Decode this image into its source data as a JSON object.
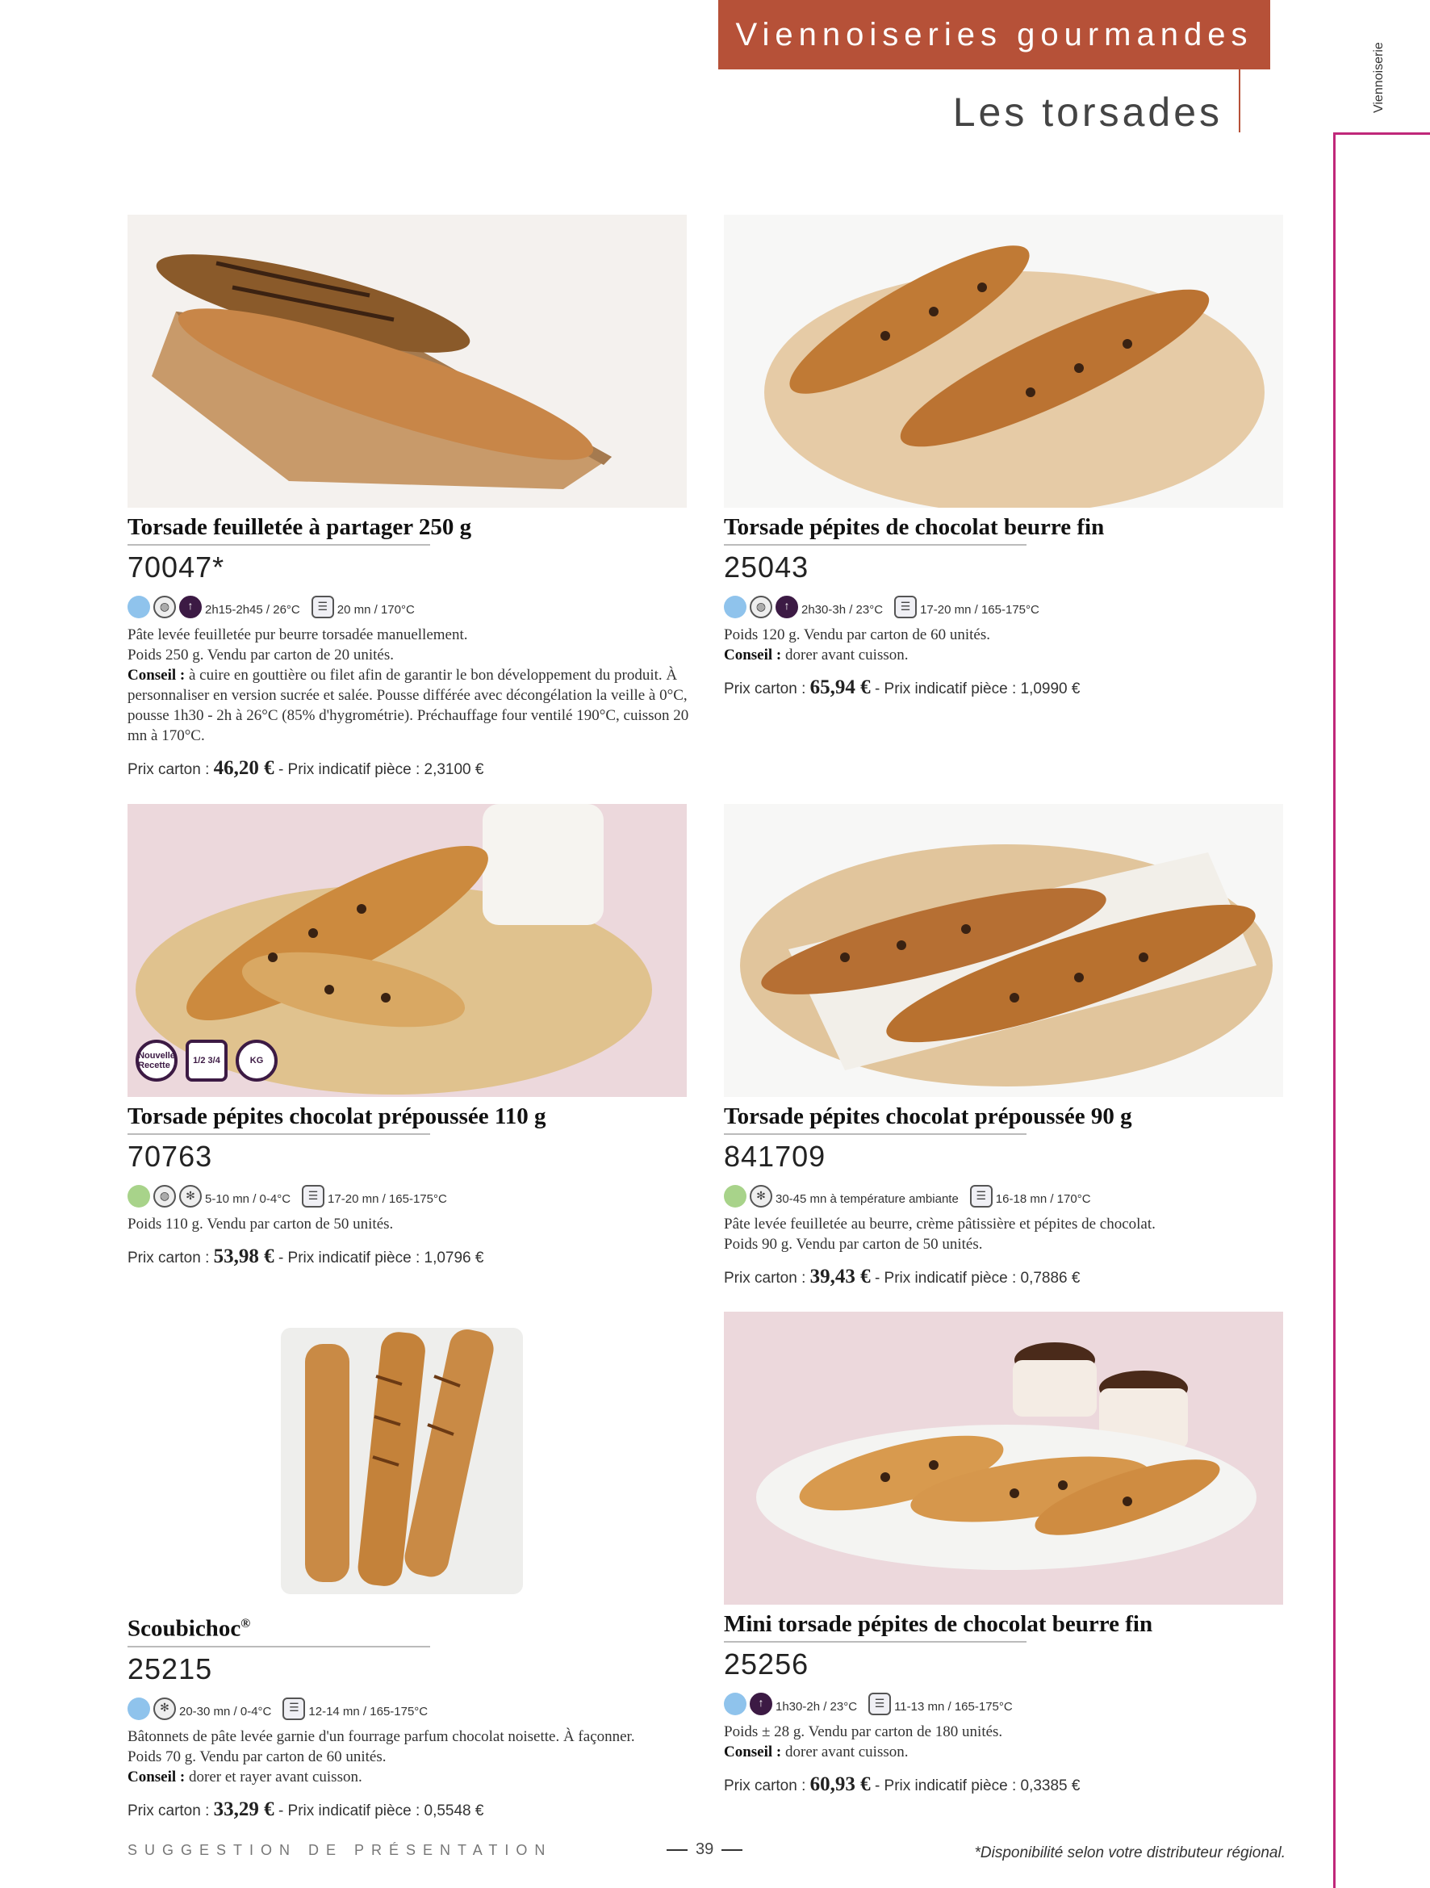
{
  "header": {
    "banner": "Viennoiseries gourmandes",
    "subtitle": "Les torsades",
    "side_label": "Viennoiserie",
    "banner_color": "#b65138",
    "accent_color": "#c0287a"
  },
  "products": [
    {
      "name": "Torsade feuilletée à partager 250 g",
      "code": "70047*",
      "dot_color": "#8fc3ec",
      "icons": [
        "butter-icon",
        "proofing-icon",
        "oven-icon"
      ],
      "proof": "2h15-2h45 / 26°C",
      "bake": "20 mn / 170°C",
      "desc": [
        "Pâte levée feuilletée pur beurre torsadée manuellement.",
        "Poids 250 g. Vendu par carton de 20 unités."
      ],
      "conseil_label": "Conseil :",
      "conseil": "à cuire en gouttière ou filet afin de garantir le bon développement du produit. À personnaliser en version sucrée et salée. Pousse différée avec décongélation la veille à 0°C, pousse 1h30 - 2h à 26°C (85% d'hygrométrie). Préchauffage four ventilé 190°C, cuisson 20 mn à 170°C.",
      "price_label": "Prix carton :",
      "price": "46,20 €",
      "unit_label": "- Prix indicatif pièce : 2,3100 €"
    },
    {
      "name": "Torsade pépites de chocolat beurre fin",
      "code": "25043",
      "dot_color": "#8fc3ec",
      "icons": [
        "butter-icon",
        "proofing-icon",
        "oven-icon"
      ],
      "proof": "2h30-3h / 23°C",
      "bake": "17-20 mn / 165-175°C",
      "desc": [
        "Poids 120 g. Vendu par carton de 60 unités."
      ],
      "conseil_label": "Conseil :",
      "conseil": "dorer avant cuisson.",
      "price_label": "Prix carton :",
      "price": "65,94 €",
      "unit_label": "- Prix indicatif pièce : 1,0990 €"
    },
    {
      "name": "Torsade pépites chocolat prépoussée 110 g",
      "code": "70763",
      "dot_color": "#a8d38a",
      "icons": [
        "butter-icon",
        "thaw-icon",
        "oven-icon"
      ],
      "proof": "5-10 mn / 0-4°C",
      "bake": "17-20 mn / 165-175°C",
      "desc": [
        "Poids 110 g. Vendu par carton de 50 unités."
      ],
      "conseil_label": "",
      "conseil": "",
      "price_label": "Prix carton :",
      "price": "53,98 €",
      "unit_label": "- Prix indicatif pièce : 1,0796 €",
      "badges": [
        "Nouvelle Recette",
        "1/2 3/4",
        "KG"
      ]
    },
    {
      "name": "Torsade pépites chocolat prépoussée 90 g",
      "code": "841709",
      "dot_color": "#a8d38a",
      "icons": [
        "thaw-icon",
        "oven-icon"
      ],
      "proof": "30-45 mn à température ambiante",
      "bake": "16-18 mn / 170°C",
      "desc": [
        "Pâte levée feuilletée au beurre, crème pâtissière et pépites de chocolat.",
        "Poids 90 g. Vendu par carton de 50 unités."
      ],
      "conseil_label": "",
      "conseil": "",
      "price_label": "Prix carton :",
      "price": "39,43 €",
      "unit_label": "- Prix indicatif pièce : 0,7886 €"
    },
    {
      "name": "Scoubichoc",
      "name_sup": "®",
      "code": "25215",
      "dot_color": "#8fc3ec",
      "icons": [
        "thaw-icon",
        "oven-icon"
      ],
      "proof": "20-30 mn / 0-4°C",
      "bake": "12-14 mn / 165-175°C",
      "desc": [
        "Bâtonnets de pâte levée garnie d'un fourrage parfum chocolat noisette. À façonner.",
        "Poids 70 g. Vendu par carton de 60 unités."
      ],
      "conseil_label": "Conseil :",
      "conseil": "dorer et rayer avant cuisson.",
      "price_label": "Prix carton :",
      "price": "33,29 €",
      "unit_label": "- Prix indicatif pièce : 0,5548 €"
    },
    {
      "name": "Mini torsade pépites de chocolat beurre fin",
      "code": "25256",
      "dot_color": "#8fc3ec",
      "icons": [
        "proofing-icon",
        "oven-icon"
      ],
      "proof": "1h30-2h / 23°C",
      "bake": "11-13 mn / 165-175°C",
      "desc": [
        "Poids ± 28 g. Vendu par carton de 180 unités."
      ],
      "conseil_label": "Conseil :",
      "conseil": "dorer avant cuisson.",
      "price_label": "Prix carton :",
      "price": "60,93 €",
      "unit_label": "- Prix indicatif pièce : 0,3385 €"
    }
  ],
  "footer": {
    "left": "SUGGESTION DE PRÉSENTATION",
    "page": "39",
    "note": "*Disponibilité selon votre distributeur régional."
  }
}
